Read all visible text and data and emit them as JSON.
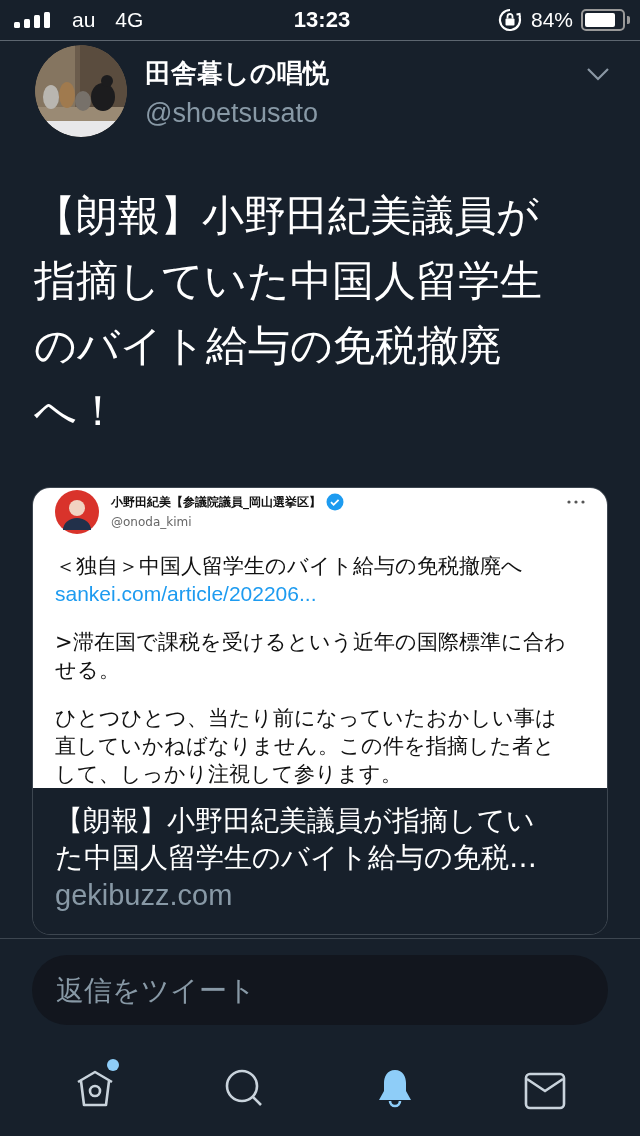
{
  "status_bar": {
    "carrier": "au",
    "network": "4G",
    "time": "13:23",
    "battery": "84%"
  },
  "tweet": {
    "author": {
      "name": "田舎暮しの唱悦",
      "handle": "@shoetsusato"
    },
    "text_lines": [
      "【朗報】小野田紀美議員が",
      "指摘していた中国人留学生",
      "のバイト給与の免税撤廃",
      "へ！"
    ],
    "card": {
      "screenshot": {
        "name": "小野田紀美【参議院議員_岡山選挙区】",
        "verified": true,
        "handle": "@onoda_kimi",
        "paragraphs": [
          {
            "kind": "text",
            "text": "＜独自＞中国人留学生のバイト給与の免税撤廃へ",
            "link": "sankei.com/article/202206..."
          },
          {
            "kind": "text",
            "text": ">滞在国で課税を受けるという近年の国際標準に合わせる。"
          },
          {
            "kind": "text",
            "text": "ひとつひとつ、当たり前になっていたおかしい事は直していかねばなりません。この件を指摘した者として、しっかり注視して参ります。"
          }
        ]
      },
      "title": "【朗報】小野田紀美議員が指摘していた中国人留学生のバイト給与の免税…",
      "domain": "gekibuzz.com"
    }
  },
  "reply": {
    "placeholder": "返信をツイート"
  },
  "tabs": [
    {
      "kind": "home",
      "selected": false,
      "badge": true
    },
    {
      "kind": "search",
      "selected": false,
      "badge": false
    },
    {
      "kind": "notifications",
      "selected": true,
      "badge": false
    },
    {
      "kind": "messages",
      "selected": false,
      "badge": false
    }
  ]
}
